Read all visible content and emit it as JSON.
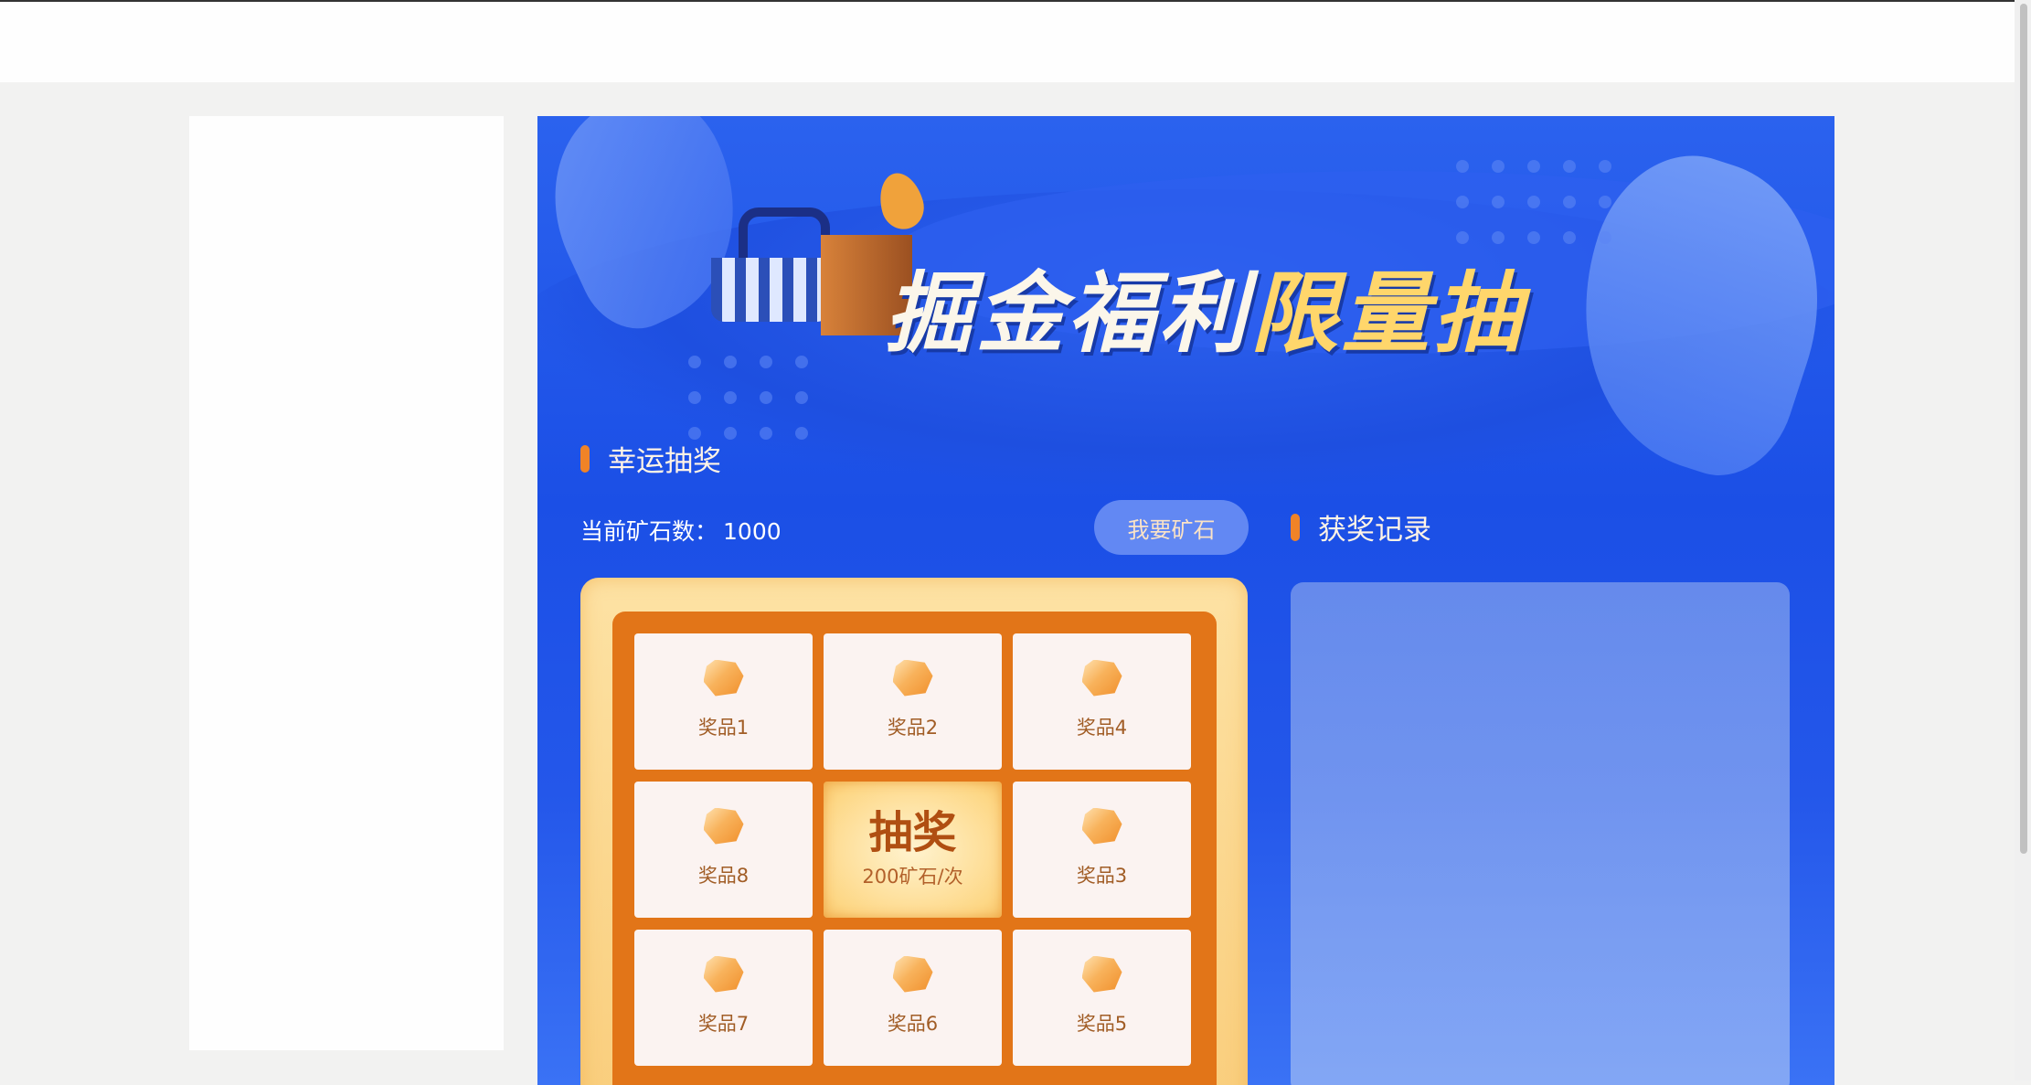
{
  "banner": {
    "title_part1": "掘金福利",
    "title_part2": "限量抽"
  },
  "lottery_section": {
    "title": "幸运抽奖",
    "ore_label": "当前矿石数：",
    "ore_count": "1000",
    "get_ore_button": "我要矿石"
  },
  "records_section": {
    "title": "获奖记录"
  },
  "grid": {
    "cells": [
      {
        "label": "奖品1",
        "icon": "ore-gem-icon"
      },
      {
        "label": "奖品2",
        "icon": "ore-gem-icon"
      },
      {
        "label": "奖品4",
        "icon": "ore-gem-icon"
      },
      {
        "label": "奖品8",
        "icon": "ore-gem-icon"
      },
      {
        "label": "奖品3",
        "icon": "ore-gem-icon"
      },
      {
        "label": "奖品7",
        "icon": "ore-gem-icon"
      },
      {
        "label": "奖品6",
        "icon": "ore-gem-icon"
      },
      {
        "label": "奖品5",
        "icon": "ore-gem-icon"
      }
    ],
    "draw_button": {
      "title": "抽奖",
      "cost": "200矿石/次"
    }
  },
  "colors": {
    "accent_orange": "#f08327",
    "primary_blue": "#1b4fe6",
    "frame_orange": "#e27518"
  }
}
